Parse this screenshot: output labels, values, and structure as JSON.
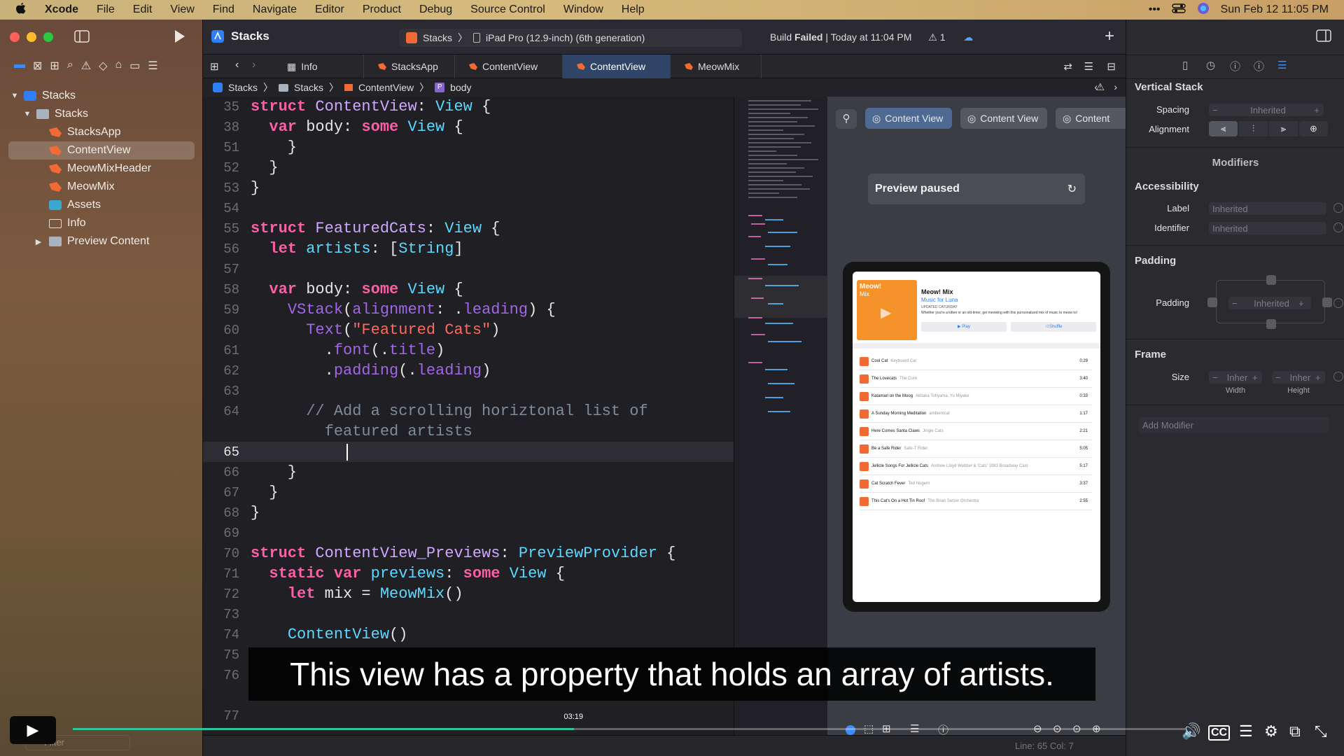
{
  "menubar": {
    "app": "Xcode",
    "items": [
      "File",
      "Edit",
      "View",
      "Find",
      "Navigate",
      "Editor",
      "Product",
      "Debug",
      "Source Control",
      "Window",
      "Help"
    ],
    "clock": "Sun Feb 12  11:05 PM"
  },
  "toolbar": {
    "project_title": "Stacks",
    "scheme": "Stacks",
    "destination": "iPad Pro (12.9-inch) (6th generation)",
    "build_status_prefix": "Build",
    "build_status_result": "Failed",
    "build_time": "Today at 11:04 PM",
    "warning_count": "1"
  },
  "navigator": {
    "items": [
      {
        "label": "Stacks",
        "icon": "project-icon",
        "level": 0
      },
      {
        "label": "Stacks",
        "icon": "folder-icon",
        "level": 1
      },
      {
        "label": "StacksApp",
        "icon": "swift-file-icon",
        "level": 2
      },
      {
        "label": "ContentView",
        "icon": "swift-file-icon",
        "level": 2,
        "selected": true
      },
      {
        "label": "MeowMixHeader",
        "icon": "swift-file-icon",
        "level": 2
      },
      {
        "label": "MeowMix",
        "icon": "swift-file-icon",
        "level": 2
      },
      {
        "label": "Assets",
        "icon": "assets-icon",
        "level": 2
      },
      {
        "label": "Info",
        "icon": "plist-icon",
        "level": 2
      },
      {
        "label": "Preview Content",
        "icon": "folder-icon",
        "level": 2
      }
    ],
    "filter_placeholder": "Filter"
  },
  "tabs": [
    {
      "label": "Info",
      "icon": "plist-icon"
    },
    {
      "label": "StacksApp",
      "icon": "swift-file-icon"
    },
    {
      "label": "ContentView",
      "icon": "swift-file-icon"
    },
    {
      "label": "ContentView",
      "icon": "swift-file-icon",
      "active": true
    },
    {
      "label": "MeowMix",
      "icon": "swift-file-icon"
    }
  ],
  "jumpbar": [
    "Stacks",
    "Stacks",
    "ContentView",
    "body"
  ],
  "editor": {
    "lines": [
      {
        "n": "35"
      },
      {
        "n": "38"
      },
      {
        "n": "51"
      },
      {
        "n": "52"
      },
      {
        "n": "53"
      },
      {
        "n": "54"
      },
      {
        "n": "55"
      },
      {
        "n": "56"
      },
      {
        "n": "57"
      },
      {
        "n": "58"
      },
      {
        "n": "59"
      },
      {
        "n": "60"
      },
      {
        "n": "61"
      },
      {
        "n": "62"
      },
      {
        "n": "63"
      },
      {
        "n": "64"
      },
      {
        "n": ""
      },
      {
        "n": "65"
      },
      {
        "n": "66"
      },
      {
        "n": "67"
      },
      {
        "n": "68"
      },
      {
        "n": "69"
      },
      {
        "n": "70"
      },
      {
        "n": "71"
      },
      {
        "n": "72"
      },
      {
        "n": "73"
      },
      {
        "n": "74"
      },
      {
        "n": "75"
      },
      {
        "n": "76"
      },
      {
        "n": "77"
      }
    ],
    "current_line": "65",
    "cursor_position": "Line: 65  Col: 7"
  },
  "canvas": {
    "preview_chips": [
      "Content View",
      "Content View",
      "Content"
    ],
    "paused_label": "Preview paused",
    "device_content": {
      "title": "Meow! Mix",
      "subtitle": "Music for Luna",
      "updated": "UPDATED CATURDAY",
      "description": "Whether you're a kitten or an old-timer, get meowing with this purrsonalized mix of music to meow to!",
      "play_label": "▶ Play",
      "shuffle_label": "⤨ Shuffle",
      "tracks": [
        {
          "title": "Cool Cat",
          "artist": "Keyboard Cat",
          "duration": "0:29"
        },
        {
          "title": "The Lovecats",
          "artist": "The Cure",
          "duration": "3:40"
        },
        {
          "title": "Katamari on the Moog",
          "artist": "Akitaka Tohyama, Yu Miyake",
          "duration": "0:33"
        },
        {
          "title": "A Sunday Morning Meditation",
          "artist": "ambientcat",
          "duration": "1:17"
        },
        {
          "title": "Here Comes Santa Claws",
          "artist": "Jingle Cats",
          "duration": "2:21"
        },
        {
          "title": "Be a Safe Rider",
          "artist": "Safe-T Rider",
          "duration": "5:05"
        },
        {
          "title": "Jellicle Songs For Jellicle Cats",
          "artist": "Andrew Lloyd Webber & 'Cats' 1983 Broadway Cast",
          "duration": "5:17"
        },
        {
          "title": "Cat Scratch Fever",
          "artist": "Ted Nugent",
          "duration": "3:37"
        },
        {
          "title": "This Cat's On a Hot Tin Roof",
          "artist": "The Brian Setzer Orchestra",
          "duration": "2:55"
        }
      ]
    }
  },
  "inspector": {
    "section_title": "Vertical Stack",
    "spacing_label": "Spacing",
    "spacing_value": "Inherited",
    "alignment_label": "Alignment",
    "modifiers_title": "Modifiers",
    "accessibility_title": "Accessibility",
    "label_label": "Label",
    "label_placeholder": "Inherited",
    "identifier_label": "Identifier",
    "identifier_placeholder": "Inherited",
    "padding_title": "Padding",
    "padding_label": "Padding",
    "padding_value": "Inherited",
    "frame_title": "Frame",
    "size_label": "Size",
    "width_value": "Inher",
    "height_value": "Inher",
    "width_label": "Width",
    "height_label": "Height",
    "add_modifier_placeholder": "Add Modifier"
  },
  "video": {
    "caption": "This view has a property that holds an array of artists.",
    "current_time": "03:19",
    "progress": 0.45
  },
  "colors": {
    "accent": "#3b8cff",
    "progress": "#2ec39a",
    "swift_icon": "#f36b34",
    "active_tab": "#2f4466"
  }
}
